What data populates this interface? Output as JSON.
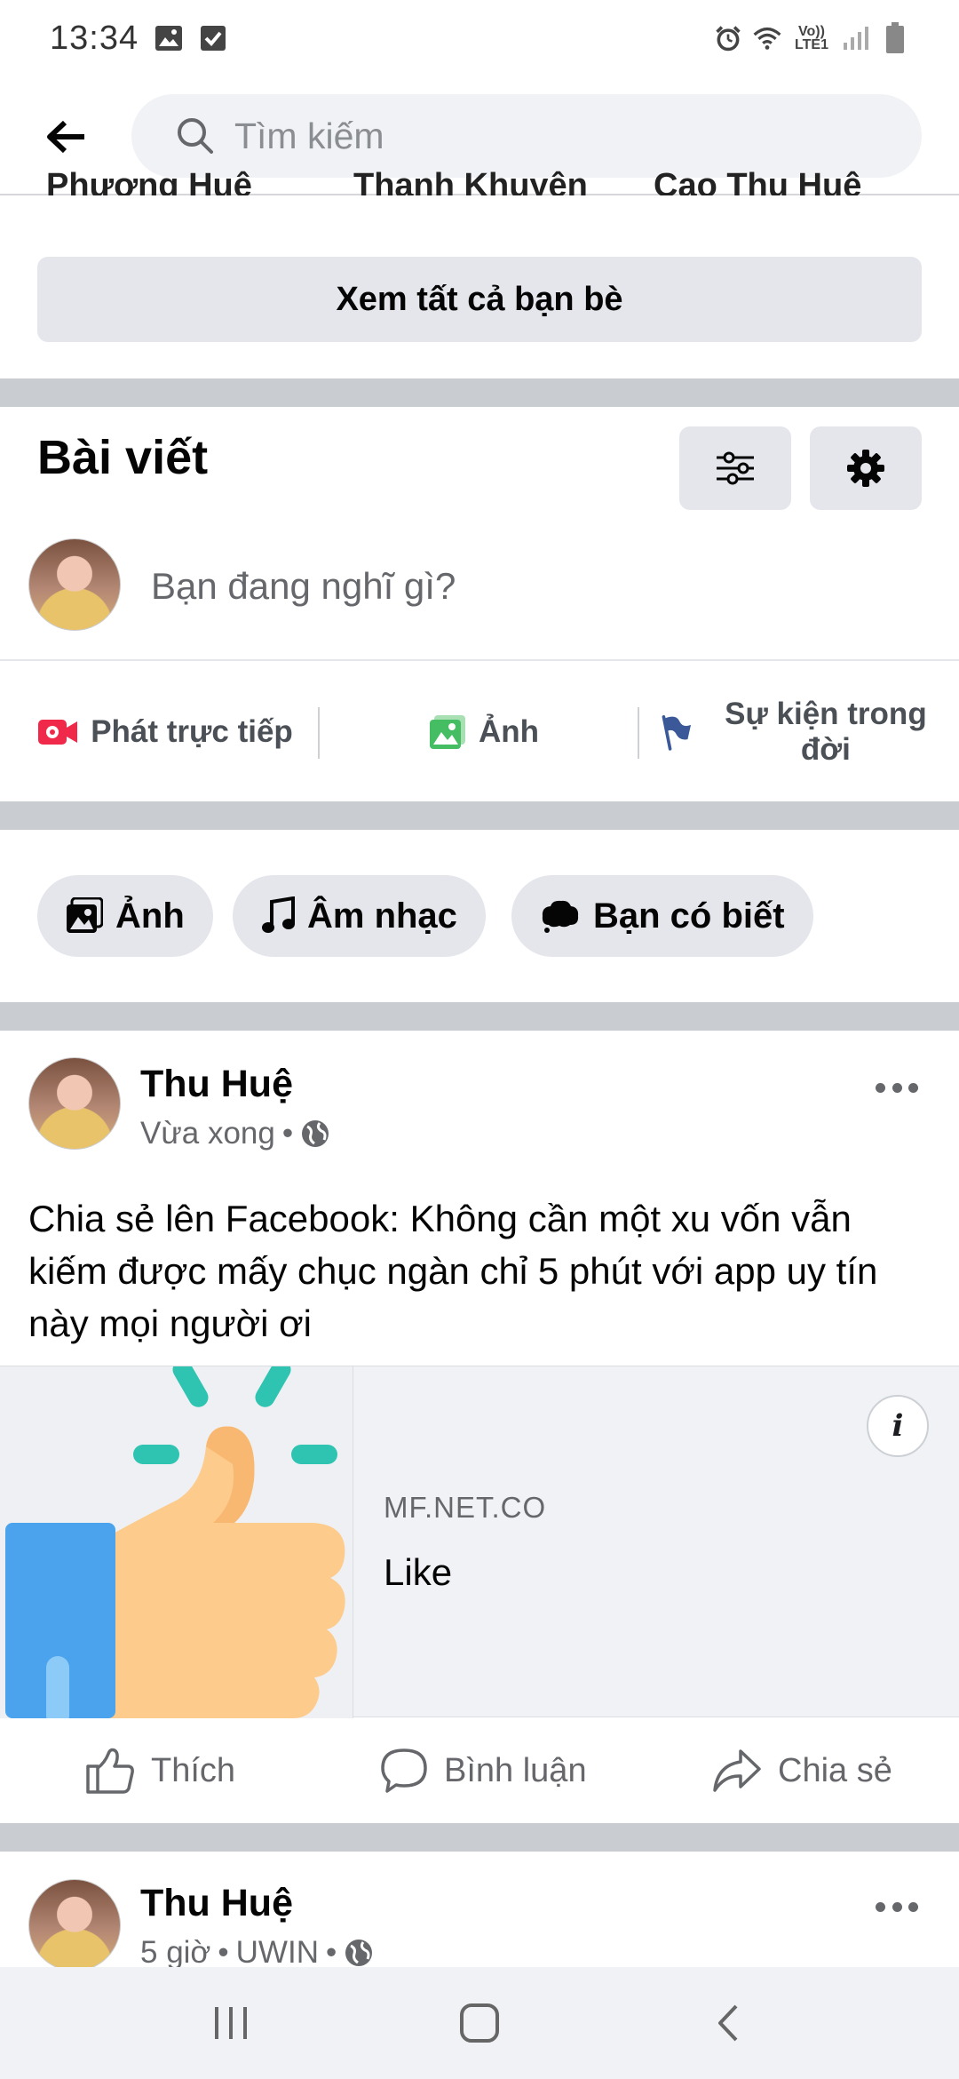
{
  "status_bar": {
    "time": "13:34",
    "network_label": "Vo)) LTE1"
  },
  "search": {
    "placeholder": "Tìm kiếm"
  },
  "friends_peek": [
    "Phương Huệ",
    "Thanh Khuyên",
    "Cao Thu Huệ"
  ],
  "friends": {
    "see_all_label": "Xem tất cả bạn bè"
  },
  "posts_section": {
    "title": "Bài viết",
    "composer_placeholder": "Bạn đang nghĩ gì?",
    "actions": [
      {
        "label": "Phát trực tiếp",
        "icon": "live-video-icon",
        "color": "#f02849"
      },
      {
        "label": "Ảnh",
        "icon": "photo-icon",
        "color": "#45bd62"
      },
      {
        "label": "Sự kiện trong đời",
        "icon": "flag-icon",
        "color": "#3b5998"
      }
    ]
  },
  "chips": [
    {
      "label": "Ảnh",
      "icon": "photo-icon"
    },
    {
      "label": "Âm nhạc",
      "icon": "music-note-icon"
    },
    {
      "label": "Bạn có biết",
      "icon": "speech-bubble-icon"
    }
  ],
  "post1": {
    "author": "Thu Huệ",
    "time": "Vừa xong",
    "separator": "•",
    "privacy_icon": "globe-icon",
    "text": "Chia sẻ lên Facebook: Không cần một xu vốn vẫn kiếm được mấy chục ngàn chỉ 5 phút với app uy tín này mọi người ơi",
    "link": {
      "domain": "MF.NET.CO",
      "title": "Like",
      "info_glyph": "i"
    },
    "actions": [
      {
        "label": "Thích",
        "icon": "thumbs-up-icon"
      },
      {
        "label": "Bình luận",
        "icon": "comment-icon"
      },
      {
        "label": "Chia sẻ",
        "icon": "share-icon"
      }
    ]
  },
  "post2": {
    "author": "Thu Huệ",
    "time": "5 giờ",
    "separator": "•",
    "app": "UWIN",
    "privacy_icon": "globe-icon"
  },
  "colors": {
    "accent_blue": "#1877f2",
    "divider_gray": "#c9ccd1",
    "button_gray": "#e4e6eb"
  }
}
